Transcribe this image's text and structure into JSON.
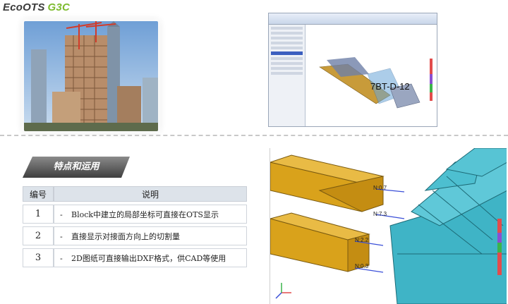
{
  "brand": {
    "name": "EcoOTS",
    "suffix": "G3C"
  },
  "software_view": {
    "label": "7BT-D-12"
  },
  "section": {
    "title": "特点和运用"
  },
  "table": {
    "headers": [
      "编号",
      "说明"
    ],
    "rows": [
      {
        "num": "1",
        "dash": "-",
        "text": "Block中建立的局部坐标可直接在OTS显示"
      },
      {
        "num": "2",
        "dash": "-",
        "text": "直接显示对接面方向上的切割量"
      },
      {
        "num": "3",
        "dash": "-",
        "text": "2D图纸可直接输出DXF格式，供CAD等使用"
      }
    ]
  },
  "model_view": {
    "labels": [
      "N:0.7",
      "N:7.3",
      "N:2.2",
      "N:0.3"
    ]
  },
  "colors": {
    "brand_green": "#7dbb2e",
    "beam_orange": "#d9a21b",
    "steel_cyan": "#3fb4c6",
    "header_gray": "#5a5a5a"
  }
}
